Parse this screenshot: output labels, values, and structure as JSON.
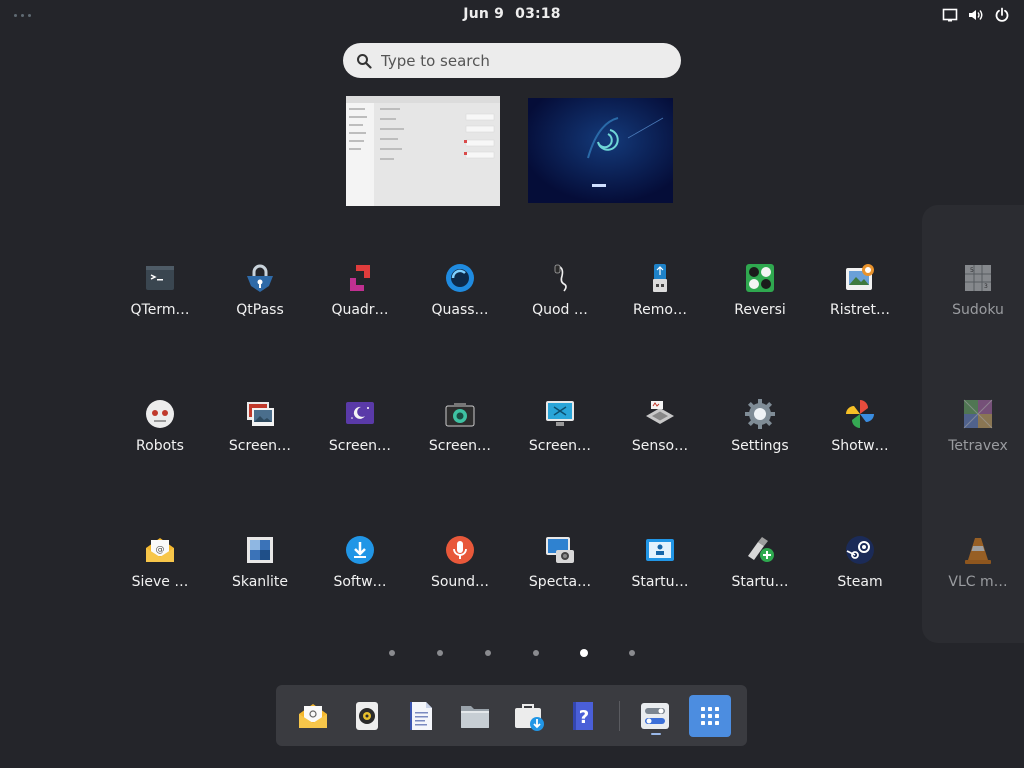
{
  "topbar": {
    "clock_date": "Jun 9",
    "clock_time": "03:18"
  },
  "search": {
    "placeholder": "Type to search"
  },
  "apps": {
    "row1": [
      "QTerm…",
      "QtPass",
      "Quadr…",
      "Quass…",
      "Quod …",
      "Remo…",
      "Reversi",
      "Ristret…"
    ],
    "row2": [
      "Robots",
      "Screen…",
      "Screen…",
      "Screen…",
      "Screen…",
      "Senso…",
      "Settings",
      "Shotw…"
    ],
    "row3": [
      "Sieve …",
      "Skanlite",
      "Softw…",
      "Sound…",
      "Specta…",
      "Startu…",
      "Startu…",
      "Steam"
    ]
  },
  "next_page_apps": [
    "Sudoku",
    "Tetravex",
    "VLC m…"
  ],
  "pages": {
    "count": 6,
    "active_index": 4
  },
  "dock": {
    "items": [
      "mail-icon",
      "speaker-icon",
      "document-icon",
      "files-icon",
      "software-icon",
      "help-icon",
      "settings-toggle-icon",
      "app-grid-icon"
    ]
  }
}
